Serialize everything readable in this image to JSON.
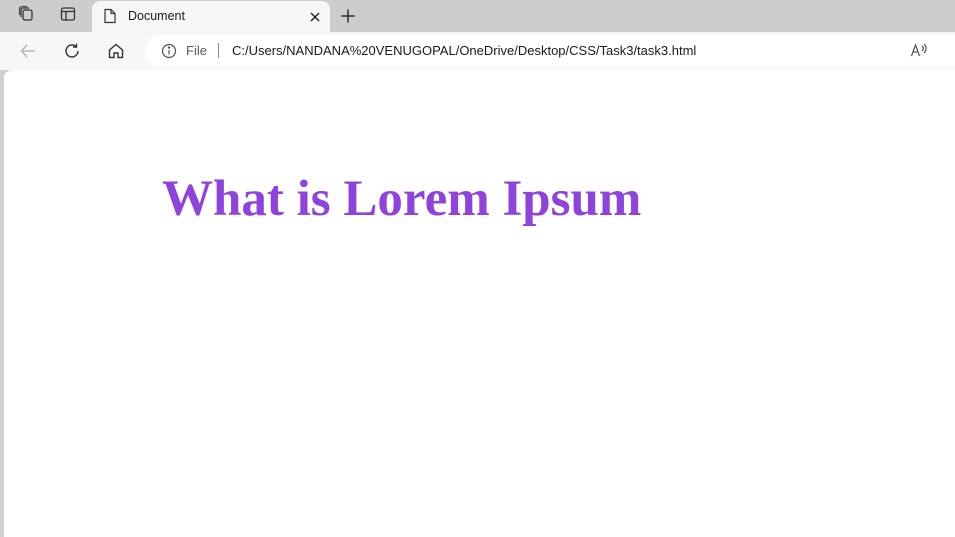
{
  "browser": {
    "tab": {
      "title": "Document",
      "favicon_icon": "document-icon"
    },
    "tabbar_icons": [
      "collections-icon",
      "vertical-tabs-icon",
      "close-icon",
      "plus-icon"
    ],
    "nav_icons": [
      "back-arrow-icon",
      "refresh-icon",
      "home-icon"
    ],
    "address_bar": {
      "scheme_label": "File",
      "url": "C:/Users/NANDANA%20VENUGOPAL/OneDrive/Desktop/CSS/Task3/task3.html",
      "icons": [
        "info-icon",
        "read-aloud-icon"
      ]
    }
  },
  "page": {
    "heading": "What is Lorem Ipsum",
    "heading_color": "#8e44dc"
  }
}
